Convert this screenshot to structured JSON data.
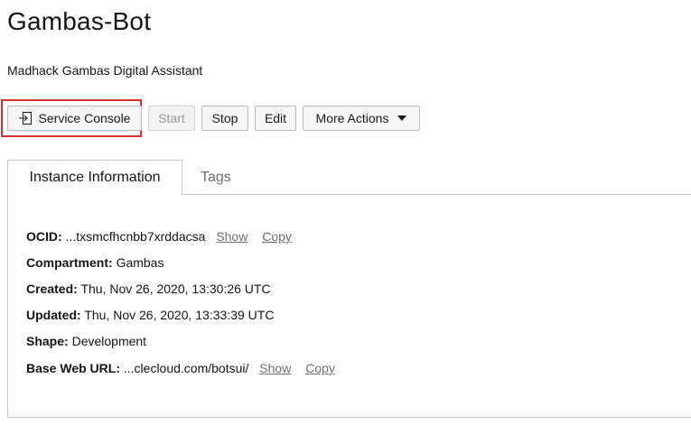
{
  "header": {
    "title": "Gambas-Bot",
    "subtitle": "Madhack Gambas Digital Assistant"
  },
  "toolbar": {
    "service_console_label": "Service Console",
    "start_label": "Start",
    "stop_label": "Stop",
    "edit_label": "Edit",
    "more_actions_label": "More Actions"
  },
  "tabs": {
    "instance_information": "Instance Information",
    "tags": "Tags"
  },
  "info": {
    "ocid_label": "OCID:",
    "ocid_value": "...txsmcfhcnbb7xrddacsa",
    "show_label": "Show",
    "copy_label": "Copy",
    "compartment_label": "Compartment:",
    "compartment_value": "Gambas",
    "created_label": "Created:",
    "created_value": "Thu, Nov 26, 2020, 13:30:26 UTC",
    "updated_label": "Updated:",
    "updated_value": "Thu, Nov 26, 2020, 13:33:39 UTC",
    "shape_label": "Shape:",
    "shape_value": "Development",
    "base_url_label": "Base Web URL:",
    "base_url_value": "...clecloud.com/botsui/"
  },
  "colors": {
    "highlight": "#d9302c",
    "link": "#6f6f6f"
  }
}
